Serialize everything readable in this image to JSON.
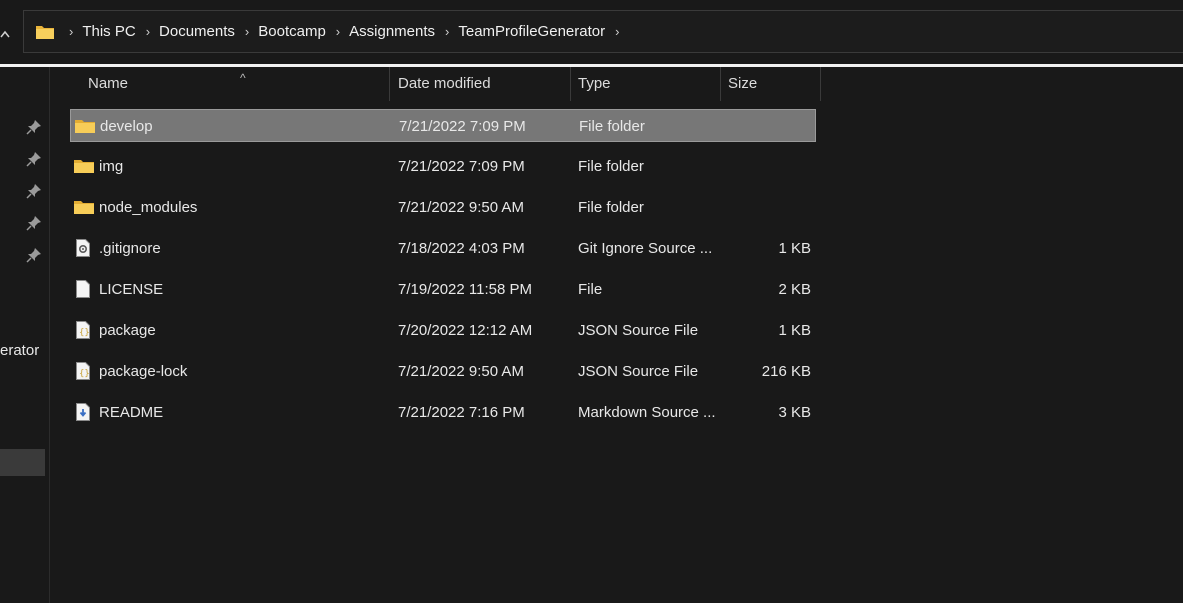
{
  "address_bar": {
    "breadcrumbs": [
      "This PC",
      "Documents",
      "Bootcamp",
      "Assignments",
      "TeamProfileGenerator"
    ],
    "separator": "›",
    "trailing_chevron": "›"
  },
  "nav": {
    "partial_label": "erator",
    "pinned_count": 5
  },
  "columns": {
    "name": "Name",
    "date": "Date modified",
    "type": "Type",
    "size": "Size"
  },
  "files": [
    {
      "name": "develop",
      "date": "7/21/2022 7:09 PM",
      "type": "File folder",
      "size": "",
      "icon": "folder-icon",
      "selected": true
    },
    {
      "name": "img",
      "date": "7/21/2022 7:09 PM",
      "type": "File folder",
      "size": "",
      "icon": "folder-icon",
      "selected": false
    },
    {
      "name": "node_modules",
      "date": "7/21/2022 9:50 AM",
      "type": "File folder",
      "size": "",
      "icon": "folder-icon",
      "selected": false
    },
    {
      "name": ".gitignore",
      "date": "7/18/2022 4:03 PM",
      "type": "Git Ignore Source ...",
      "size": "1 KB",
      "icon": "gitignore-file-icon",
      "selected": false
    },
    {
      "name": "LICENSE",
      "date": "7/19/2022 11:58 PM",
      "type": "File",
      "size": "2 KB",
      "icon": "blank-file-icon",
      "selected": false
    },
    {
      "name": "package",
      "date": "7/20/2022 12:12 AM",
      "type": "JSON Source File",
      "size": "1 KB",
      "icon": "json-file-icon",
      "selected": false
    },
    {
      "name": "package-lock",
      "date": "7/21/2022 9:50 AM",
      "type": "JSON Source File",
      "size": "216 KB",
      "icon": "json-file-icon",
      "selected": false
    },
    {
      "name": "README",
      "date": "7/21/2022 7:16 PM",
      "type": "Markdown Source ...",
      "size": "3 KB",
      "icon": "markdown-file-icon",
      "selected": false
    }
  ],
  "colors": {
    "background": "#191919",
    "selection": "#777777",
    "folder": "#f3c64b"
  }
}
